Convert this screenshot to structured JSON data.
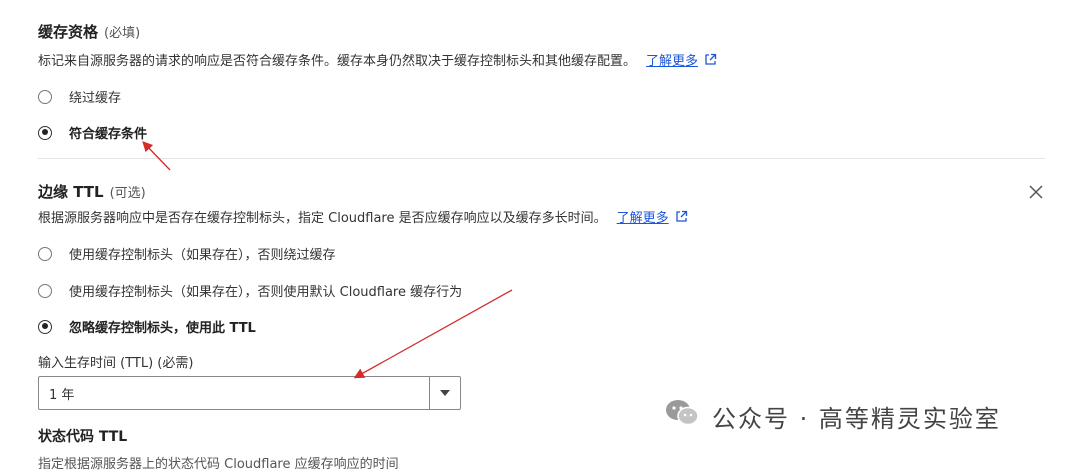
{
  "cache_eligibility": {
    "title": "缓存资格",
    "optional_tag": "(必填)",
    "description": "标记来自源服务器的请求的响应是否符合缓存条件。缓存本身仍然取决于缓存控制标头和其他缓存配置。",
    "learn_more": "了解更多",
    "options": [
      {
        "label": "绕过缓存",
        "checked": false
      },
      {
        "label": "符合缓存条件",
        "checked": true
      }
    ]
  },
  "edge_ttl": {
    "title": "边缘 TTL",
    "optional_tag": "(可选)",
    "description": "根据源服务器响应中是否存在缓存控制标头，指定 Cloudflare 是否应缓存响应以及缓存多长时间。",
    "learn_more": "了解更多",
    "options": [
      {
        "label": "使用缓存控制标头（如果存在），否则绕过缓存",
        "checked": false
      },
      {
        "label": "使用缓存控制标头（如果存在），否则使用默认 Cloudflare 缓存行为",
        "checked": false
      },
      {
        "label": "忽略缓存控制标头，使用此 TTL",
        "checked": true
      }
    ],
    "ttl_input_label": "输入生存时间 (TTL) (必需)",
    "ttl_value": "1 年"
  },
  "status_code_ttl": {
    "title": "状态代码 TTL",
    "description_partial": "指定根据源服务器上的状态代码 Cloudflare 应缓存响应的时间"
  },
  "watermark": {
    "text": "公众号 · 高等精灵实验室"
  },
  "colors": {
    "link": "#1a56db",
    "annotation_arrow": "#d42b2b"
  }
}
